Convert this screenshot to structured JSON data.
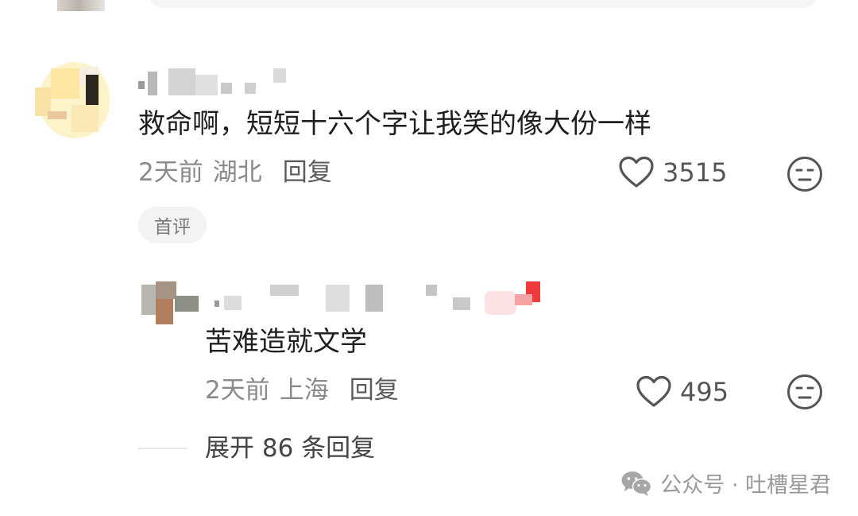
{
  "comments": [
    {
      "text": "救命啊，短短十六个字让我笑的像大份一样",
      "time": "2天前",
      "location": "湖北",
      "reply_label": "回复",
      "likes": "3515",
      "tag": "首评",
      "replies": [
        {
          "text": "苦难造就文学",
          "time": "2天前",
          "location": "上海",
          "reply_label": "回复",
          "likes": "495"
        }
      ],
      "expand_label": "展开 86 条回复"
    }
  ],
  "watermark": {
    "text": "公众号 · 吐槽星君",
    "icon": "wechat-icon"
  },
  "icons": {
    "like": "heart-outline-icon",
    "reaction": "neutral-face-icon"
  },
  "colors": {
    "text_primary": "#1f1f1f",
    "text_meta": "#8a8a8a",
    "tag_bg": "#f3f3f3",
    "watermark": "#9a9a9a"
  }
}
